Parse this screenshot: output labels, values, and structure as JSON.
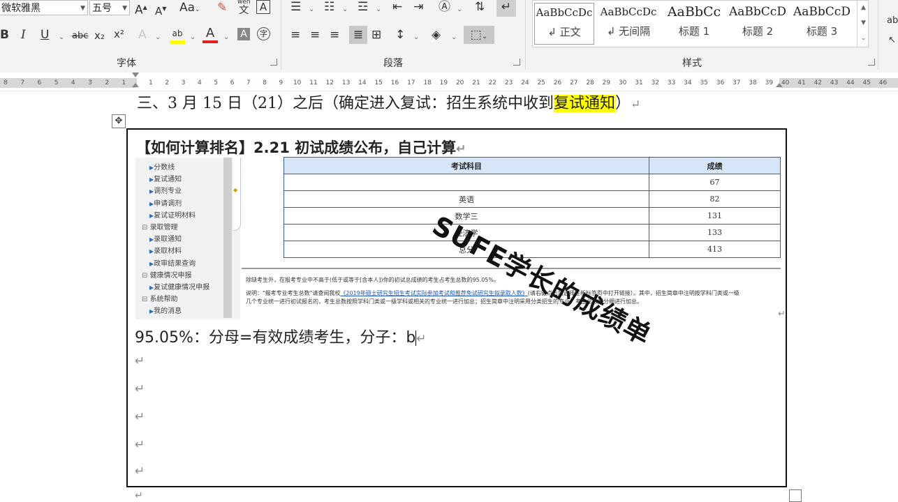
{
  "ribbon": {
    "font_name": "微软雅黑",
    "font_size": "五号",
    "aa_label": "Aa",
    "wen_label": "wén",
    "wen_char": "文",
    "A_label": "A",
    "bold": "B",
    "italic": "I",
    "underline": "U",
    "strike": "abc",
    "subscript": "x₂",
    "superscript": "x²",
    "ab_label": "ab",
    "circle_char": "字",
    "groups": {
      "font": "字体",
      "paragraph": "段落",
      "styles": "样式"
    },
    "styles": [
      {
        "preview": "AaBbCcDc",
        "name": "↲ 正文"
      },
      {
        "preview": "AaBbCcDc",
        "name": "↲ 无间隔"
      },
      {
        "preview": "AaBbCc",
        "name": "标题 1"
      },
      {
        "preview": "AaBbCcD",
        "name": "标题 2"
      },
      {
        "preview": "AaBbCcD",
        "name": "标题 3"
      }
    ],
    "colors": {
      "highlight": "#ffff00",
      "font_color": "#e02020",
      "selected_style_border": "#9d9d9d"
    }
  },
  "ruler": {
    "left_numbers": [
      "8",
      "7",
      "6",
      "5",
      "4",
      "3",
      "2",
      "1"
    ],
    "right_numbers": [
      "1",
      "2",
      "3",
      "4",
      "5",
      "6",
      "7",
      "8",
      "9",
      "10",
      "11",
      "12",
      "13",
      "14",
      "15",
      "16",
      "17",
      "18",
      "19",
      "20",
      "21",
      "22",
      "23",
      "24",
      "25",
      "26",
      "27",
      "28",
      "29",
      "30",
      "31",
      "32",
      "33",
      "34",
      "35",
      "36",
      "37",
      "38",
      "39",
      "40",
      "41",
      "42",
      "43",
      "44",
      "45",
      "46"
    ]
  },
  "document": {
    "heading_pre": "三、3 月 15 日（21）之后（确定进入复试：招生系统中收到",
    "heading_highlight": "复试通知",
    "heading_post": "）",
    "para_mark": "↵",
    "frame_title": "【如何计算排名】2.21 初试成绩公布，自己计算",
    "sidebar": [
      {
        "text": "分数线",
        "type": "sub"
      },
      {
        "text": "复试通知",
        "type": "sub"
      },
      {
        "text": "调剂专业",
        "type": "sub"
      },
      {
        "text": "申请调剂",
        "type": "sub"
      },
      {
        "text": "复试证明材料",
        "type": "sub"
      },
      {
        "text": "录取管理",
        "type": "group"
      },
      {
        "text": "录取通知",
        "type": "sub"
      },
      {
        "text": "录取材料",
        "type": "sub"
      },
      {
        "text": "政审结果查询",
        "type": "sub"
      },
      {
        "text": "健康情况申报",
        "type": "group"
      },
      {
        "text": "复试健康情况申报",
        "type": "sub"
      },
      {
        "text": "系统帮助",
        "type": "group"
      },
      {
        "text": "我的消息",
        "type": "sub"
      }
    ],
    "table": {
      "headers": [
        "考试科目",
        "成绩"
      ],
      "rows": [
        [
          "",
          "67"
        ],
        [
          "英语",
          "82"
        ],
        [
          "数学三",
          "131"
        ],
        [
          "经济学",
          "133"
        ],
        [
          "总分",
          "413"
        ]
      ]
    },
    "stamp_text": "SUFE学长的成绩单",
    "note1": "除缺考生外，在报考专业中不高于(低于或等于[含本人])你的初试总成绩的考生占考生总数的95.05%。",
    "note2_pre": "说明：\"报考专业考生总数\"请查阅我校",
    "note2_link": "《2019年硕士研究生招生考试实际参加考试和推荐免试研究生拟录取人数》",
    "note2_post": "(请右键点击后选择在新标签页中打开链接）。其中，招生简章中注明按学科门类或一级",
    "note3": "几个专业统一进行初试报名的，考生总数按照学科门类或一级学科或相关的专业统一进行加总；招生简章中注明采用分类招生的专业，考生总数则分细进行加总。",
    "formula": "95.05%：分母=有效成绩考生，分子：b"
  }
}
